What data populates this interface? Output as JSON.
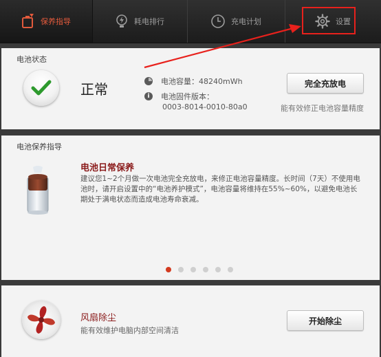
{
  "tabs": [
    {
      "label": "保养指导",
      "icon": "battery-care-icon",
      "active": true
    },
    {
      "label": "耗电排行",
      "icon": "bulb-icon",
      "active": false
    },
    {
      "label": "充电计划",
      "icon": "clock-icon",
      "active": false
    },
    {
      "label": "设置",
      "icon": "gear-icon",
      "active": false
    }
  ],
  "status": {
    "section_title": "电池状态",
    "state": "正常",
    "capacity_label": "电池容量：48240mWh",
    "firmware_label": "电池固件版本：",
    "firmware_value": "0003-8014-0010-80a0",
    "button_label": "完全充放电",
    "button_hint": "能有效修正电池容量精度"
  },
  "guide": {
    "section_title": "电池保养指导",
    "title": "电池日常保养",
    "body": "建议您1~2个月做一次电池完全充放电，来修正电池容量精度。长时间（7天）不使用电池时，请开启设置中的“电池养护模式”，电池容量将维持在55%~60%，以避免电池长期处于满电状态而造成电池寿命衰减。",
    "page_count": 6,
    "current_page": 1
  },
  "fan": {
    "title": "风扇除尘",
    "description": "能有效维护电脑内部空间清洁",
    "button_label": "开始除尘"
  },
  "colors": {
    "accent": "#e25a3c",
    "highlight": "#e8211c",
    "title_red": "#8a1a1a"
  }
}
